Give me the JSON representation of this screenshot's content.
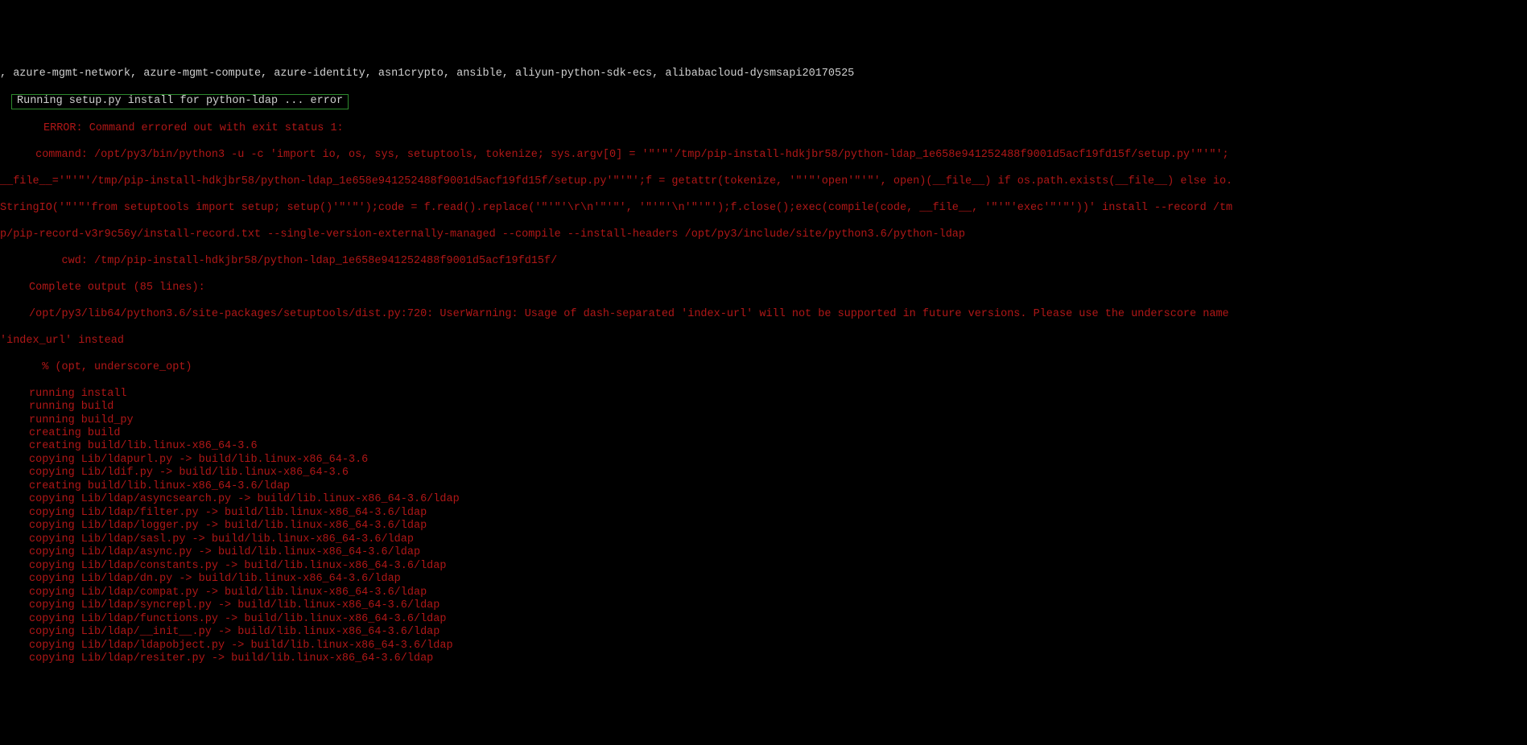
{
  "top_line": ", azure-mgmt-network, azure-mgmt-compute, azure-identity, asn1crypto, ansible, aliyun-python-sdk-ecs, alibabacloud-dysmsapi20170525",
  "highlight_line": "Running setup.py install for python-ldap ... error",
  "error_header": "ERROR: Command errored out with exit status 1:",
  "cmd1": " command: /opt/py3/bin/python3 -u -c 'import io, os, sys, setuptools, tokenize; sys.argv[0] = '\"'\"'/tmp/pip-install-hdkjbr58/python-ldap_1e658e941252488f9001d5acf19fd15f/setup.py'\"'\"';",
  "cmd2": "__file__='\"'\"'/tmp/pip-install-hdkjbr58/python-ldap_1e658e941252488f9001d5acf19fd15f/setup.py'\"'\"';f = getattr(tokenize, '\"'\"'open'\"'\"', open)(__file__) if os.path.exists(__file__) else io.",
  "cmd3": "StringIO('\"'\"'from setuptools import setup; setup()'\"'\"');code = f.read().replace('\"'\"'\\r\\n'\"'\"', '\"'\"'\\n'\"'\"');f.close();exec(compile(code, __file__, '\"'\"'exec'\"'\"'))' install --record /tm",
  "cmd4": "p/pip-record-v3r9c56y/install-record.txt --single-version-externally-managed --compile --install-headers /opt/py3/include/site/python3.6/python-ldap",
  "cwd": "     cwd: /tmp/pip-install-hdkjbr58/python-ldap_1e658e941252488f9001d5acf19fd15f/",
  "complete_output": "Complete output (85 lines):",
  "warning": "/opt/py3/lib64/python3.6/site-packages/setuptools/dist.py:720: UserWarning: Usage of dash-separated 'index-url' will not be supported in future versions. Please use the underscore name ",
  "warning2": "'index_url' instead",
  "opt_line": "  % (opt, underscore_opt)",
  "build_lines": [
    "running install",
    "running build",
    "running build_py",
    "creating build",
    "creating build/lib.linux-x86_64-3.6",
    "copying Lib/ldapurl.py -> build/lib.linux-x86_64-3.6",
    "copying Lib/ldif.py -> build/lib.linux-x86_64-3.6",
    "creating build/lib.linux-x86_64-3.6/ldap",
    "copying Lib/ldap/asyncsearch.py -> build/lib.linux-x86_64-3.6/ldap",
    "copying Lib/ldap/filter.py -> build/lib.linux-x86_64-3.6/ldap",
    "copying Lib/ldap/logger.py -> build/lib.linux-x86_64-3.6/ldap",
    "copying Lib/ldap/sasl.py -> build/lib.linux-x86_64-3.6/ldap",
    "copying Lib/ldap/async.py -> build/lib.linux-x86_64-3.6/ldap",
    "copying Lib/ldap/constants.py -> build/lib.linux-x86_64-3.6/ldap",
    "copying Lib/ldap/dn.py -> build/lib.linux-x86_64-3.6/ldap",
    "copying Lib/ldap/compat.py -> build/lib.linux-x86_64-3.6/ldap",
    "copying Lib/ldap/syncrepl.py -> build/lib.linux-x86_64-3.6/ldap",
    "copying Lib/ldap/functions.py -> build/lib.linux-x86_64-3.6/ldap",
    "copying Lib/ldap/__init__.py -> build/lib.linux-x86_64-3.6/ldap",
    "copying Lib/ldap/ldapobject.py -> build/lib.linux-x86_64-3.6/ldap",
    "copying Lib/ldap/resiter.py -> build/lib.linux-x86_64-3.6/ldap"
  ]
}
